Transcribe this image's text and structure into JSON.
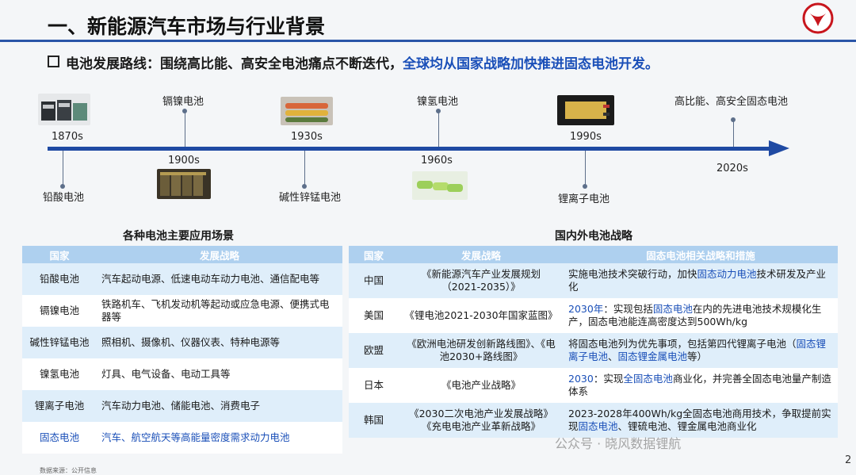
{
  "header": {
    "title": "一、新能源汽车市场与行业背景",
    "subtitle_a": "电池发展路线：围绕高比能、高安全电池痛点不断迭代，",
    "subtitle_b": "全球均从国家战略加快推进固态电池开发。"
  },
  "timeline": {
    "top": [
      {
        "year": "1870s",
        "name": ""
      },
      {
        "year": "1930s",
        "name": ""
      },
      {
        "year": "1990s",
        "name": ""
      }
    ],
    "labels": {
      "lead": "铅酸电池",
      "nicd": "镉镍电池",
      "alk": "碱性锌锰电池",
      "nimh": "镍氢电池",
      "liion": "锂离子电池",
      "solid": "高比能、高安全固态电池",
      "y1870": "1870s",
      "y1900": "1900s",
      "y1930": "1930s",
      "y1960": "1960s",
      "y1990": "1990s",
      "y2020": "2020s"
    }
  },
  "left_table": {
    "heading": "各种电池主要应用场景",
    "headers": [
      "国家",
      "发展战略"
    ],
    "rows": [
      {
        "name": "铅酸电池",
        "desc": "汽车起动电源、低速电动车动力电池、通信配电等"
      },
      {
        "name": "镉镍电池",
        "desc": "铁路机车、飞机发动机等起动或应急电源、便携式电器等"
      },
      {
        "name": "碱性锌锰电池",
        "desc": "照相机、摄像机、仪器仪表、特种电源等"
      },
      {
        "name": "镍氢电池",
        "desc": "灯具、电气设备、电动工具等"
      },
      {
        "name": "锂离子电池",
        "desc": "汽车动力电池、储能电池、消费电子"
      },
      {
        "name": "固态电池",
        "desc": "汽车、航空航天等高能量密度需求动力电池"
      }
    ]
  },
  "right_table": {
    "heading": "国内外电池战略",
    "headers": [
      "国家",
      "发展战略",
      "固态电池相关战略和措施"
    ],
    "rows": [
      {
        "country": "中国",
        "strategy": "《新能源汽车产业发展规划（2021-2035）》",
        "m1": "实施电池技术突破行动，加快",
        "m2": "固态动力电池",
        "m3": "技术研发及产业化"
      },
      {
        "country": "美国",
        "strategy": "《锂电池2021-2030年国家蓝图》",
        "m1": "2030年",
        "m2": "：实现包括",
        "m3": "固态电池",
        "m4": "在内的先进电池技术规模化生产，固态电池能连高密度达到500Wh/kg"
      },
      {
        "country": "欧盟",
        "strategy": "《欧洲电池研发创新路线图》、《电池2030+路线图》",
        "m1": "将固态电池列为优先事项，包括第四代锂离子电池（",
        "m2": "固态锂离子电池",
        "m3": "、",
        "m4": "固态锂金属电池",
        "m5": "等）"
      },
      {
        "country": "日本",
        "strategy": "《电池产业战略》",
        "m1": "2030",
        "m2": "：实现",
        "m3": "全固态电池",
        "m4": "商业化，并完善全固态电池量产制造体系"
      },
      {
        "country": "韩国",
        "strategy": "《2030二次电池产业发展战略》《充电电池产业革新战略》",
        "m1": "2023-2028年400Wh/kg全固态电池商用技术，争取提前实现",
        "m2": "固态电池",
        "m3": "、锂硫电池、锂金属电池商业化"
      }
    ]
  },
  "watermark": "公众号 · 晓风数据锂航",
  "source": "数据来源：公开信息",
  "page_number": "2",
  "colors": {
    "accent": "#1f4aa3",
    "header_fill": "#aed0ef",
    "row_fill": "#dfeefa",
    "highlight": "#1a4fb8"
  }
}
